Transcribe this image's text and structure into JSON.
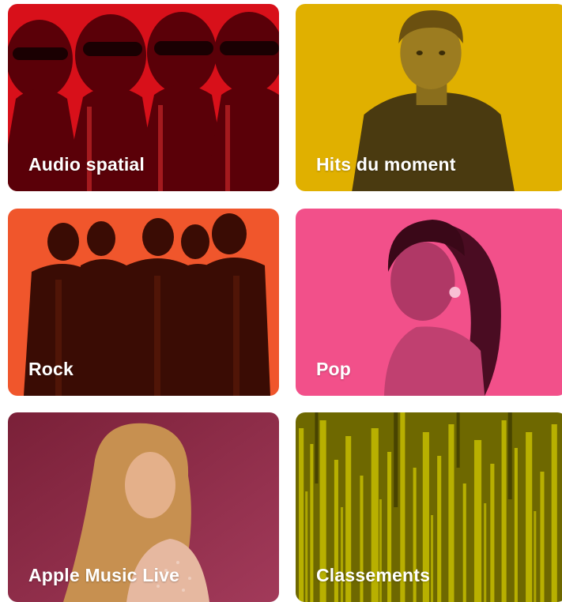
{
  "grid": {
    "tiles": [
      {
        "label": "Audio spatial",
        "color": "#e8101a",
        "art": "repeated-figures-with-sunglasses"
      },
      {
        "label": "Hits du moment",
        "color": "#e0b000",
        "art": "portrait-man-in-sweater"
      },
      {
        "label": "Rock",
        "color": "#f0562c",
        "art": "band-group-photo"
      },
      {
        "label": "Pop",
        "color": "#f2508a",
        "art": "portrait-woman-high-ponytail"
      },
      {
        "label": "Apple Music Live",
        "color": "#8e2a48",
        "art": "portrait-woman-long-hair"
      },
      {
        "label": "Classements",
        "color": "#8a8400",
        "art": "vertical-bars-texture"
      }
    ]
  }
}
